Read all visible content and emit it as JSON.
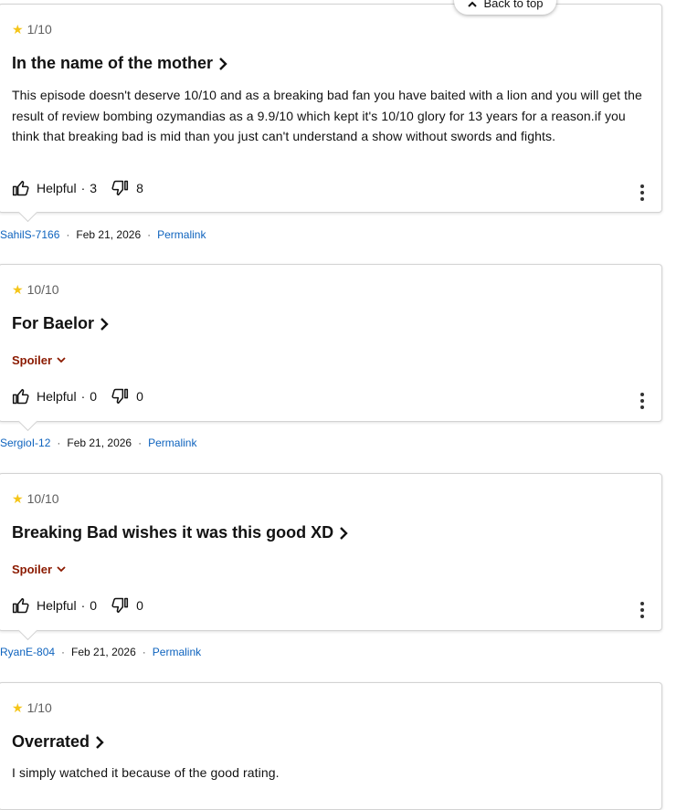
{
  "back_to_top": {
    "label": "Back to top"
  },
  "reviews": [
    {
      "rating": "1/10",
      "title": "In the name of the mother",
      "body": "This episode doesn't deserve 10/10 and as a breaking bad fan you have baited with a lion and you will get the result of review bombing ozymandias as a 9.9/10 which kept it's 10/10 glory for 13 years for a reason.if you think that breaking bad is mid than you just can't understand a show without swords and fights.",
      "helpful_label": "Helpful",
      "helpful_count": "3",
      "unhelpful_count": "8",
      "author": "SahilS-7166",
      "date": "Feb 21, 2026",
      "permalink": "Permalink"
    },
    {
      "rating": "10/10",
      "title": "For Baelor",
      "spoiler": "Spoiler",
      "helpful_label": "Helpful",
      "helpful_count": "0",
      "unhelpful_count": "0",
      "author": "SergioI-12",
      "date": "Feb 21, 2026",
      "permalink": "Permalink"
    },
    {
      "rating": "10/10",
      "title": "Breaking Bad wishes it was this good XD",
      "spoiler": "Spoiler",
      "helpful_label": "Helpful",
      "helpful_count": "0",
      "unhelpful_count": "0",
      "author": "RyanE-804",
      "date": "Feb 21, 2026",
      "permalink": "Permalink"
    },
    {
      "rating": "1/10",
      "title": "Overrated",
      "body": "I simply watched it because of the good rating."
    }
  ],
  "colors": {
    "star": "#f5c518",
    "link": "#0e63be",
    "spoiler": "#8b1a00"
  },
  "icons": {
    "star": "star-icon",
    "chevron": "chevron-right-icon",
    "thumbs_up": "thumbs-up-icon",
    "thumbs_down": "thumbs-down-icon",
    "more": "more-options-icon",
    "back": "chevron-up-icon"
  }
}
